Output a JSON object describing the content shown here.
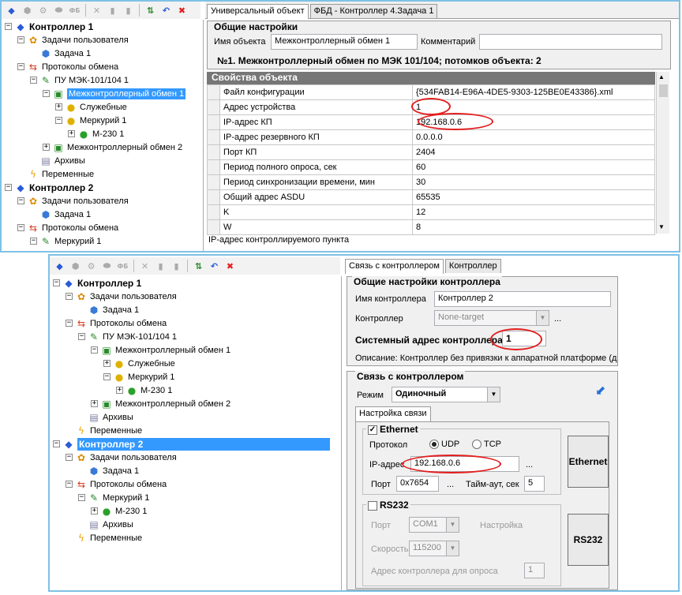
{
  "top": {
    "tree": [
      {
        "exp": "⊟",
        "icon": "controller",
        "label": "Контроллер 1",
        "bold": true
      },
      {
        "exp": "⊟",
        "icon": "tasks",
        "label": "Задачи пользователя"
      },
      {
        "exp": "",
        "icon": "cube",
        "label": "Задача 1"
      },
      {
        "exp": "⊟",
        "icon": "protocols",
        "label": "Протоколы обмена"
      },
      {
        "exp": "⊟",
        "icon": "plug",
        "label": "ПУ МЭК-101/104 1"
      },
      {
        "exp": "⊟",
        "icon": "exchange",
        "label": "Межконтроллерный обмен 1",
        "selected": true
      },
      {
        "exp": "⊞",
        "icon": "service",
        "label": "Служебные"
      },
      {
        "exp": "⊟",
        "icon": "service",
        "label": "Меркурий 1"
      },
      {
        "exp": "⊞",
        "icon": "meter",
        "label": "М-230 1"
      },
      {
        "exp": "⊞",
        "icon": "exchange",
        "label": "Межконтроллерный обмен 2"
      },
      {
        "exp": "",
        "icon": "archive",
        "label": "Архивы"
      },
      {
        "exp": "",
        "icon": "vars",
        "label": "Переменные"
      },
      {
        "exp": "⊟",
        "icon": "controller",
        "label": "Контроллер 2",
        "bold": true
      },
      {
        "exp": "⊟",
        "icon": "tasks",
        "label": "Задачи пользователя"
      },
      {
        "exp": "",
        "icon": "cube",
        "label": "Задача 1"
      },
      {
        "exp": "⊟",
        "icon": "protocols",
        "label": "Протоколы обмена"
      },
      {
        "exp": "⊟",
        "icon": "plug",
        "label": "Меркурий 1"
      }
    ],
    "tabs": [
      "Универсальный объект",
      "ФБД - Контроллер 4.Задача 1"
    ],
    "general_title": "Общие настройки",
    "name_label": "Имя объекта",
    "name_value": "Межконтроллерный обмен 1",
    "comment_label": "Комментарий",
    "comment_value": "",
    "summary": "№1. Межконтроллерный обмен по МЭК 101/104; потомков объекта: 2",
    "props_title": "Свойства объекта",
    "props": [
      {
        "k": "Файл конфигурации",
        "v": "{534FAB14-E96A-4DE5-9303-125BE0E43386}.xml"
      },
      {
        "k": "Адрес устройства",
        "v": "1"
      },
      {
        "k": "IP-адрес КП",
        "v": "192.168.0.6"
      },
      {
        "k": "IP-адрес резервного КП",
        "v": "0.0.0.0"
      },
      {
        "k": "Порт КП",
        "v": "2404"
      },
      {
        "k": "Период полного опроса, сек",
        "v": "60"
      },
      {
        "k": "Период синхронизации времени, мин",
        "v": "30"
      },
      {
        "k": "Общий адрес ASDU",
        "v": "65535"
      },
      {
        "k": "K",
        "v": "12"
      },
      {
        "k": "W",
        "v": "8"
      }
    ],
    "status": "IP-адрес контроллируемого пункта"
  },
  "bottom": {
    "tree": [
      {
        "exp": "⊟",
        "icon": "controller",
        "label": "Контроллер 1",
        "bold": true
      },
      {
        "exp": "⊟",
        "icon": "tasks",
        "label": "Задачи пользователя"
      },
      {
        "exp": "",
        "icon": "cube",
        "label": "Задача 1"
      },
      {
        "exp": "⊟",
        "icon": "protocols",
        "label": "Протоколы обмена"
      },
      {
        "exp": "⊟",
        "icon": "plug",
        "label": "ПУ МЭК-101/104 1"
      },
      {
        "exp": "⊟",
        "icon": "exchange",
        "label": "Межконтроллерный обмен 1"
      },
      {
        "exp": "⊞",
        "icon": "service",
        "label": "Служебные"
      },
      {
        "exp": "⊟",
        "icon": "service",
        "label": "Меркурий 1"
      },
      {
        "exp": "⊞",
        "icon": "meter",
        "label": "М-230 1"
      },
      {
        "exp": "⊞",
        "icon": "exchange",
        "label": "Межконтроллерный обмен 2"
      },
      {
        "exp": "",
        "icon": "archive",
        "label": "Архивы"
      },
      {
        "exp": "",
        "icon": "vars",
        "label": "Переменные"
      },
      {
        "exp": "⊟",
        "icon": "controller",
        "label": "Контроллер 2",
        "bold": true,
        "selected": true
      },
      {
        "exp": "⊟",
        "icon": "tasks",
        "label": "Задачи пользователя"
      },
      {
        "exp": "",
        "icon": "cube",
        "label": "Задача 1"
      },
      {
        "exp": "⊟",
        "icon": "protocols",
        "label": "Протоколы обмена"
      },
      {
        "exp": "⊟",
        "icon": "plug",
        "label": "Меркурий 1"
      },
      {
        "exp": "⊞",
        "icon": "meter",
        "label": "М-230 1"
      },
      {
        "exp": "",
        "icon": "archive",
        "label": "Архивы"
      },
      {
        "exp": "",
        "icon": "vars",
        "label": "Переменные"
      }
    ],
    "tabs": [
      "Связь с контроллером",
      "Контроллер"
    ],
    "general_title": "Общие настройки контроллера",
    "ctrl_name_label": "Имя контроллера",
    "ctrl_name_value": "Контроллер 2",
    "ctrl_label": "Контроллер",
    "ctrl_value": "None-target",
    "sys_addr_label": "Системный адрес контроллера",
    "sys_addr_value": "1",
    "description": "Описание: Контроллер без привязки к аппаратной платформе (д.",
    "link_title": "Связь с контроллером",
    "mode_label": "Режим",
    "mode_value": "Одиночный",
    "link_tab": "Настройка связи",
    "eth_title": "Ethernet",
    "proto_label": "Протокол",
    "udp_label": "UDP",
    "tcp_label": "TCP",
    "ip_label": "IP-адрес",
    "ip_value": "192.168.0.6",
    "port_label": "Порт",
    "port_value": "0x7654",
    "timeout_label": "Тайм-аут, сек",
    "timeout_value": "5",
    "rs_title": "RS232",
    "rs_port_label": "Порт",
    "rs_port_value": "COM1",
    "rs_setup_label": "Настройка",
    "rs_speed_label": "Скорость",
    "rs_speed_value": "115200",
    "rs_addr_label": "Адрес контроллера для опроса",
    "rs_addr_value": "1",
    "btn_eth": "Ethernet",
    "btn_rs": "RS232",
    "ellipsis": "..."
  },
  "colors": {
    "accent": "#3399ff",
    "highlight": "#e41e1e",
    "frame": "#7fc1e6"
  }
}
